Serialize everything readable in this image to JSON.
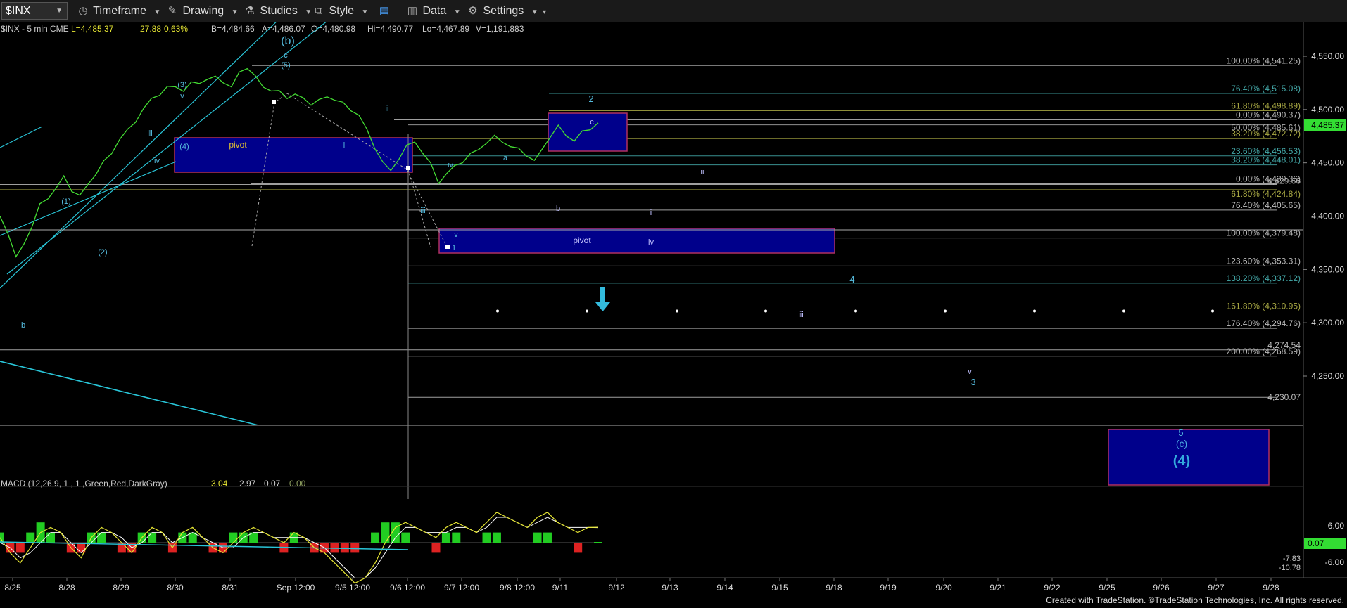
{
  "toolbar": {
    "symbol": "$INX",
    "items": [
      {
        "id": "timeframe",
        "label": "Timeframe",
        "icon": "clock-icon"
      },
      {
        "id": "drawing",
        "label": "Drawing",
        "icon": "pencil-icon"
      },
      {
        "id": "studies",
        "label": "Studies",
        "icon": "flask-icon"
      },
      {
        "id": "style",
        "label": "Style",
        "icon": "style-icon"
      },
      {
        "id": "layout",
        "label": "",
        "icon": "layout-icon"
      },
      {
        "id": "data",
        "label": "Data",
        "icon": "bar-chart-icon"
      },
      {
        "id": "settings",
        "label": "Settings",
        "icon": "gear-icon"
      }
    ]
  },
  "header": {
    "symbol": "$INX - 5 min  CME",
    "fields": [
      {
        "k": "L",
        "v": "4,485.37"
      },
      {
        "k": "",
        "v": "27.88"
      },
      {
        "k": "",
        "v": "0.63%"
      },
      {
        "k": "B",
        "v": "4,484.66"
      },
      {
        "k": "A",
        "v": "4,486.07"
      },
      {
        "k": "O",
        "v": "4,480.98"
      },
      {
        "k": "Hi",
        "v": "4,490.77"
      },
      {
        "k": "Lo",
        "v": "4,467.89"
      },
      {
        "k": "V",
        "v": "1,191,883"
      }
    ]
  },
  "price_axis": {
    "ticks": [
      "4,550.00",
      "4,500.00",
      "4,450.00",
      "4,400.00",
      "4,350.00",
      "4,300.00",
      "4,250.00"
    ],
    "last_price": "4,485.37",
    "last_price_color": "#33dd33"
  },
  "time_axis": {
    "labels": [
      "8/25",
      "8/28",
      "8/29",
      "8/30",
      "8/31",
      "Sep 12:00",
      "9/5 12:00",
      "9/6 12:00",
      "9/7 12:00",
      "9/8 12:00",
      "9/11",
      "9/12",
      "9/13",
      "9/14",
      "9/15",
      "9/18",
      "9/19",
      "9/20",
      "9/21",
      "9/22",
      "9/25",
      "9/26",
      "9/27",
      "9/28"
    ]
  },
  "footer": {
    "credit": "Created with TradeStation. ©TradeStation Technologies, Inc. All rights reserved."
  },
  "chart_data": {
    "type": "line",
    "title": "$INX - 5 min",
    "ylim": [
      4215,
      4580
    ],
    "price_levels": [
      {
        "label": "100.00% (4,541.25)",
        "value": 4541.25,
        "color": "#bbbbbb"
      },
      {
        "label": "76.40% (4,515.08)",
        "value": 4515.08,
        "color": "#44aaaa"
      },
      {
        "label": "61.80% (4,498.89)",
        "value": 4498.89,
        "color": "#aaaa44"
      },
      {
        "label": "0.00% (4,490.37)",
        "value": 4490.37,
        "color": "#bbbbbb"
      },
      {
        "label": "50.00% (4,485.61)",
        "value": 4485.61,
        "color": "#aaaaaa"
      },
      {
        "label": "38.20% (4,472.72)",
        "value": 4472.72,
        "color": "#aaaa44"
      },
      {
        "label": "23.60% (4,456.53)",
        "value": 4456.53,
        "color": "#44aaaa"
      },
      {
        "label": "38.20% (4,448.01)",
        "value": 4448.01,
        "color": "#44aaaa"
      },
      {
        "label": "0.00% (4,430.36)",
        "value": 4430.36,
        "color": "#bbbbbb"
      },
      {
        "label": "4,429.66",
        "value": 4429.66,
        "color": "#bbbbbb"
      },
      {
        "label": "61.80% (4,424.84)",
        "value": 4424.84,
        "color": "#aaaa44"
      },
      {
        "label": "76.40% (4,405.65)",
        "value": 4405.65,
        "color": "#bbbbbb"
      },
      {
        "label": "100.00% (4,379.48)",
        "value": 4379.48,
        "color": "#bbbbbb"
      },
      {
        "label": "123.60% (4,353.31)",
        "value": 4353.31,
        "color": "#bbbbbb"
      },
      {
        "label": "138.20% (4,337.12)",
        "value": 4337.12,
        "color": "#44aaaa"
      },
      {
        "label": "161.80% (4,310.95)",
        "value": 4310.95,
        "color": "#aaaa44"
      },
      {
        "label": "176.40% (4,294.76)",
        "value": 4294.76,
        "color": "#bbbbbb"
      },
      {
        "label": "4,274.54",
        "value": 4274.54,
        "color": "#bbbbbb"
      },
      {
        "label": "200.00% (4,268.59)",
        "value": 4268.59,
        "color": "#bbbbbb"
      },
      {
        "label": "4,230.07",
        "value": 4230.07,
        "color": "#bbbbbb"
      }
    ],
    "series": [
      {
        "values": [
          4400,
          4385,
          4360,
          4375,
          4390,
          4410,
          4418,
          4425,
          4437,
          4425,
          4418,
          4430,
          4440,
          4450,
          4460,
          4472,
          4480,
          4490,
          4500,
          4510,
          4515,
          4520,
          4522,
          4518,
          4524,
          4526,
          4528,
          4530,
          4527,
          4520,
          4535,
          4540,
          4530,
          4522,
          4518,
          4516,
          4512,
          4514,
          4510,
          4506,
          4508,
          4512,
          4510,
          4505,
          4500,
          4495,
          4480,
          4465,
          4450,
          4442,
          4455,
          4465,
          4470,
          4460,
          4448,
          4432,
          4440,
          4446,
          4452,
          4458,
          4462,
          4470,
          4474,
          4470,
          4466,
          4462,
          4458,
          4452,
          4462,
          4476,
          4484,
          4475,
          4472,
          4478,
          4482,
          4488
        ]
      }
    ],
    "wave_labels": [
      {
        "text": "(b)",
        "value": 4570
      },
      {
        "text": "c",
        "value": 4555
      },
      {
        "text": "(5)",
        "value": 4547
      },
      {
        "text": "(3)",
        "value": 4530
      },
      {
        "text": "v",
        "value": 4520
      },
      {
        "text": "iii",
        "value": 4494
      },
      {
        "text": "iv",
        "value": 4476
      },
      {
        "text": "(4)",
        "value": 4485
      },
      {
        "text": "pivot",
        "value": 4485
      },
      {
        "text": "ii",
        "value": 4521
      },
      {
        "text": "i",
        "value": 4485
      },
      {
        "text": "(1)",
        "value": 4442
      },
      {
        "text": "(2)",
        "value": 4412
      },
      {
        "text": "b",
        "value": 4354
      },
      {
        "text": "iii",
        "value": 4440
      },
      {
        "text": "iv",
        "value": 4477
      },
      {
        "text": "v",
        "value": 4419
      },
      {
        "text": "1",
        "value": 4410
      },
      {
        "text": "a",
        "value": 4484
      },
      {
        "text": "b",
        "value": 4445
      },
      {
        "text": "2",
        "value": 4530
      },
      {
        "text": "c",
        "value": 4505
      },
      {
        "text": "pivot",
        "value": 4415
      },
      {
        "text": "ii",
        "value": 4467
      },
      {
        "text": "i",
        "value": 4442
      },
      {
        "text": "iv",
        "value": 4415
      },
      {
        "text": "4",
        "value": 4382
      },
      {
        "text": "iii",
        "value": 4354
      },
      {
        "text": "v",
        "value": 4314
      },
      {
        "text": "3",
        "value": 4302
      },
      {
        "text": "5",
        "value": 4264
      },
      {
        "text": "(c)",
        "value": 4255
      },
      {
        "text": "(4)",
        "value": 4237
      }
    ],
    "macd": {
      "label": "MACD (12,26,9, 1 , 1 ,Green,Red,DarkGray)",
      "values": [
        "3.04",
        "2.97",
        "0.07",
        "0.00"
      ],
      "axis_ticks": [
        "6.00",
        "0.07",
        "-6.00"
      ],
      "extra_labels": [
        "-7.83",
        "-10.78"
      ],
      "macd_line": [
        1,
        -2,
        -4,
        -1,
        2,
        3,
        2,
        -1,
        -3,
        1,
        3,
        2,
        0,
        -2,
        1,
        3,
        2,
        -1,
        2,
        3,
        1,
        -1,
        -2,
        0,
        2,
        3,
        2,
        1,
        0,
        2,
        1,
        -1,
        -2,
        -4,
        -6,
        -8,
        -7,
        -4,
        0,
        3,
        4,
        3,
        2,
        1,
        3,
        4,
        3,
        2,
        4,
        6,
        5,
        4,
        3,
        5,
        6,
        4,
        3,
        2,
        3,
        3.04
      ],
      "signal_line": [
        0,
        -1,
        -3,
        -2,
        0,
        2,
        2,
        0,
        -2,
        0,
        2,
        2,
        1,
        -1,
        0,
        2,
        2,
        0,
        1,
        2,
        1,
        0,
        -1,
        -1,
        1,
        2,
        2,
        1,
        1,
        1,
        1,
        0,
        -1,
        -3,
        -5,
        -7,
        -7,
        -5,
        -2,
        1,
        3,
        3,
        2,
        2,
        2,
        3,
        3,
        2,
        3,
        5,
        5,
        4,
        3,
        4,
        5,
        4,
        3,
        3,
        3,
        2.97
      ]
    }
  }
}
